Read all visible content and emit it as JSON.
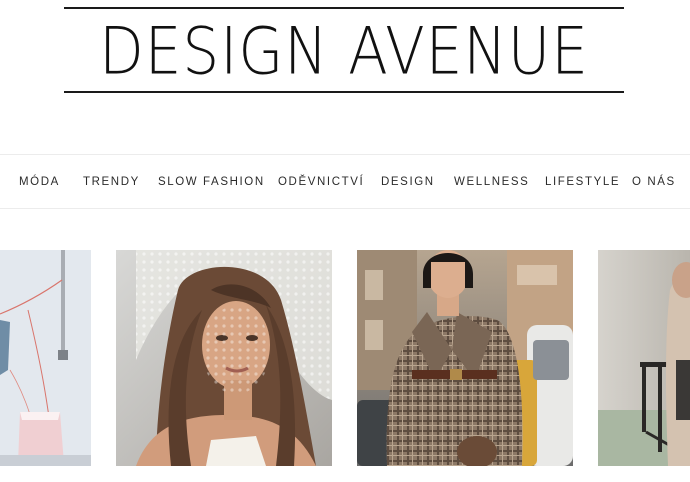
{
  "site": {
    "logo_text": "DESIGN AVENUE"
  },
  "nav": {
    "items": [
      {
        "label": "MÓDA"
      },
      {
        "label": "TRENDY"
      },
      {
        "label": "SLOW FASHION"
      },
      {
        "label": "ODĚVNICTVÍ"
      },
      {
        "label": "DESIGN"
      },
      {
        "label": "WELLNESS"
      },
      {
        "label": "LIFESTYLE"
      },
      {
        "label": "O NÁS"
      }
    ]
  },
  "featured": {
    "cards": [
      {
        "icon": "hanging-clothes-photo"
      },
      {
        "icon": "woman-with-lace-shadow-photo"
      },
      {
        "icon": "woman-in-plaid-blazer-photo"
      },
      {
        "icon": "seated-person-photo"
      }
    ]
  },
  "colors": {
    "text": "#111111",
    "nav_text": "#2b2b2b",
    "divider": "#ececec"
  }
}
